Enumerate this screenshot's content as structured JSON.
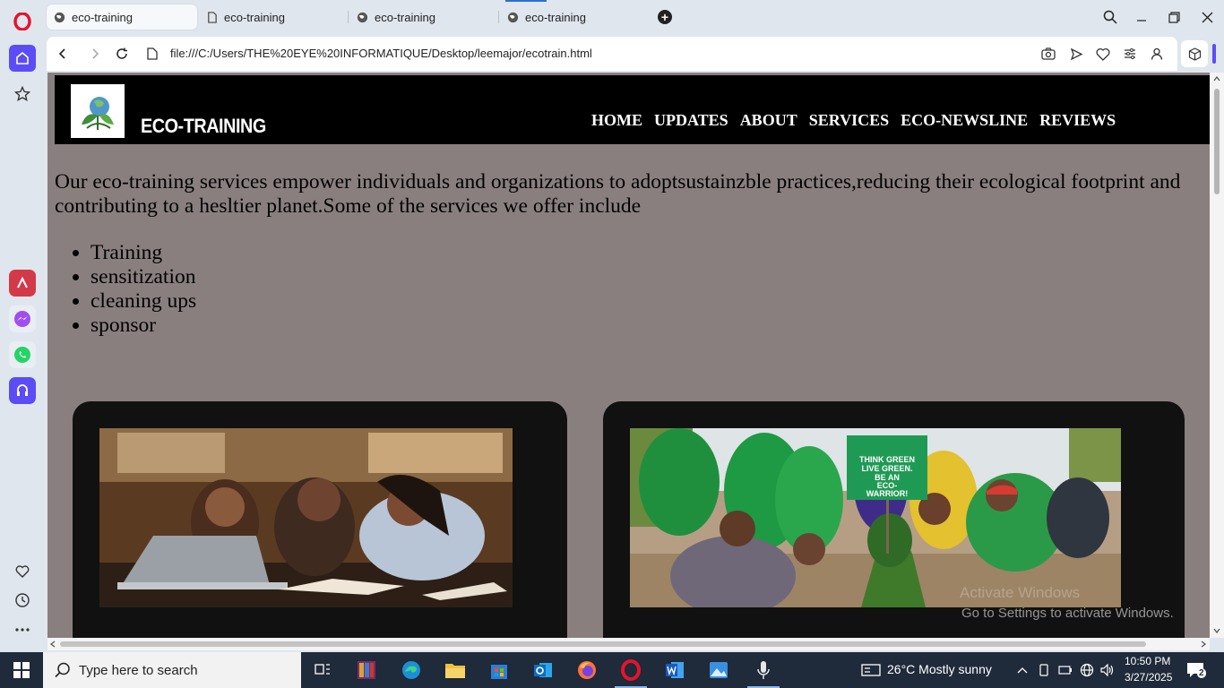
{
  "browser": {
    "tabs": [
      {
        "title": "eco-training",
        "active": true
      },
      {
        "title": "eco-training",
        "active": false
      },
      {
        "title": "eco-training",
        "active": false
      },
      {
        "title": "eco-training",
        "active": false
      }
    ],
    "url": "file:///C:/Users/THE%20EYE%20INFORMATIQUE/Desktop/leemajor/ecotrain.html"
  },
  "site": {
    "title": "ECO-TRAINING",
    "nav": [
      "HOME",
      "UPDATES",
      "ABOUT",
      "SERVICES",
      "ECO-NEWSLINE",
      "REVIEWS"
    ],
    "intro": "Our eco-training services empower individuals and organizations to adoptsustainzble practices,reducing their ecological footprint and contributing to a hesltier planet.Some of the services we offer include",
    "services": [
      "Training",
      "sensitization",
      "cleaning ups",
      "sponsor"
    ],
    "sign": {
      "line1": "THINK GREEN",
      "line2": "LIVE GREEN.",
      "line3": "BE AN",
      "line4": "ECO-",
      "line5": "WARRIOR!"
    }
  },
  "watermark": {
    "title": "Activate Windows",
    "subtitle": "Go to Settings to activate Windows."
  },
  "taskbar": {
    "search_placeholder": "Type here to search",
    "weather": "26°C  Mostly sunny",
    "time": "10:50 PM",
    "date": "3/27/2025",
    "notification_count": "2"
  },
  "colors": {
    "page_bg": "#8a7f7f",
    "header_bg": "#000000",
    "card_bg": "#111111",
    "opera_accent": "#5b4cf5"
  }
}
